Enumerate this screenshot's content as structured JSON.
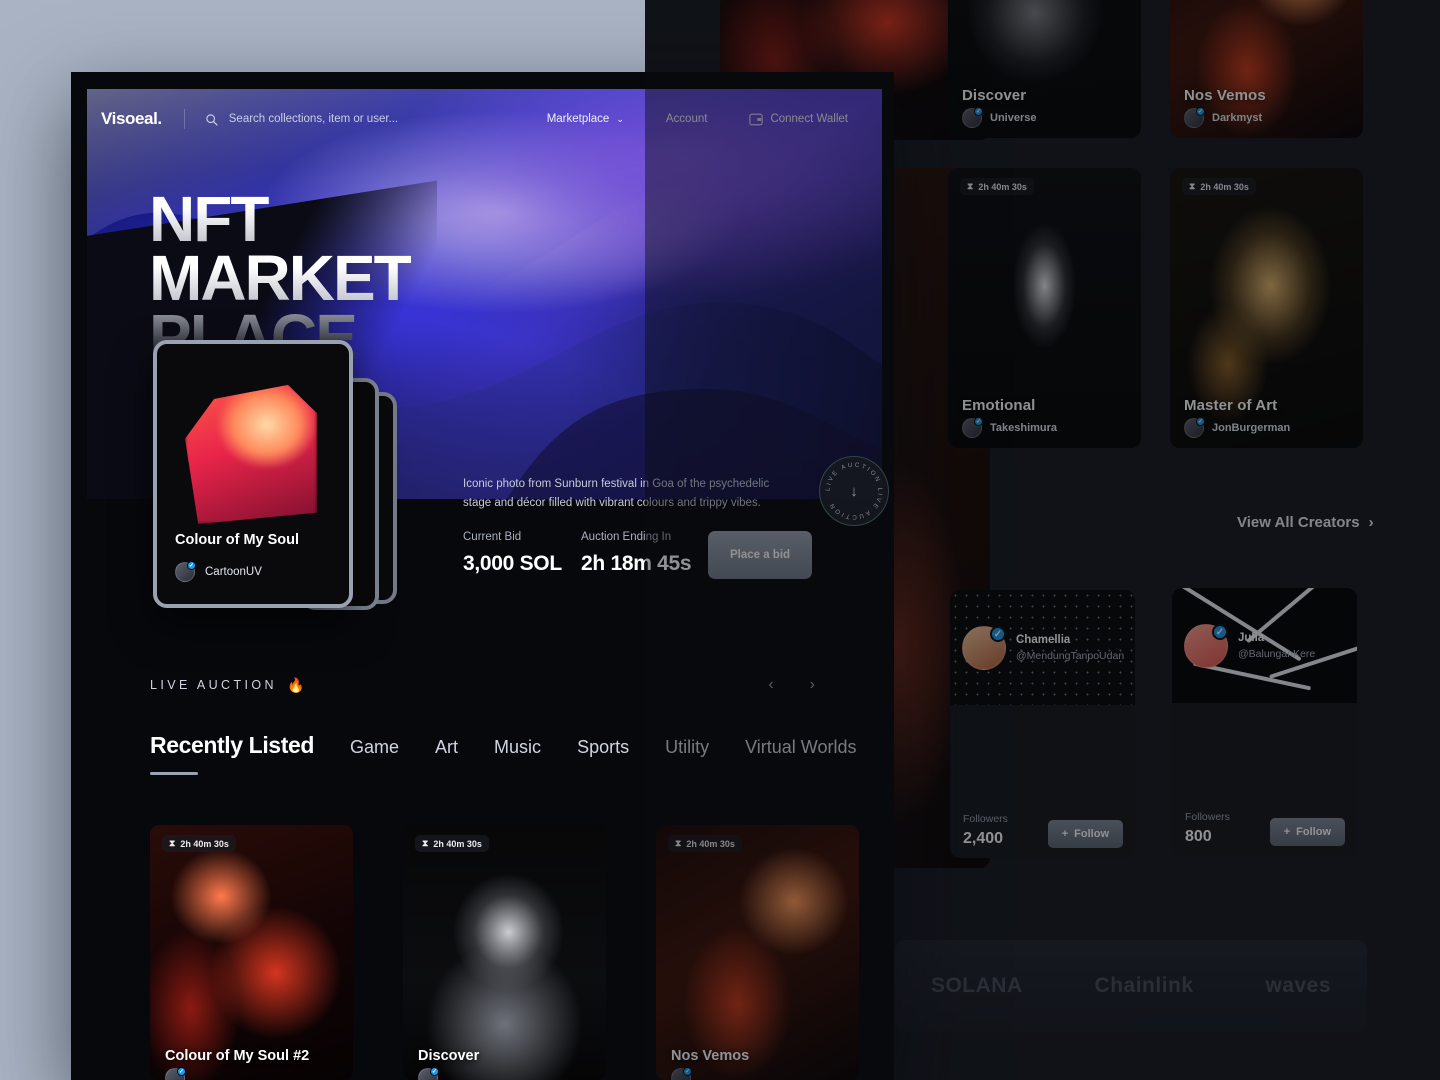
{
  "brand": {
    "logo": "Visoeal."
  },
  "search": {
    "placeholder": "Search collections, item or user..."
  },
  "nav": {
    "marketplace": "Marketplace",
    "account": "Account",
    "connect_wallet": "Connect Wallet"
  },
  "hero": {
    "line1": "NFT",
    "line2": "MARKET",
    "line3": "PLACE",
    "badge_text": "LIVE AUCTION LIVE AUCTION ",
    "description": "Iconic photo from Sunburn festival in Goa of the psychedelic stage and décor filled with vibrant colours and trippy vibes.",
    "current_bid_label": "Current Bid",
    "current_bid_value": "3,000 SOL",
    "ending_label": "Auction Ending In",
    "ending_value": "2h 18m 45s",
    "bid_button": "Place a bid",
    "card": {
      "title": "Colour of My Soul",
      "author": "CartoonUV"
    }
  },
  "live_auction": {
    "label": "LIVE AUCTION",
    "fire": "🔥"
  },
  "tabs": [
    {
      "label": "Recently Listed",
      "active": true
    },
    {
      "label": "Game",
      "active": false
    },
    {
      "label": "Art",
      "active": false
    },
    {
      "label": "Music",
      "active": false
    },
    {
      "label": "Sports",
      "active": false
    },
    {
      "label": "Utility",
      "active": false
    },
    {
      "label": "Virtual Worlds",
      "active": false
    }
  ],
  "listed_cards": [
    {
      "title": "Colour of My Soul #2",
      "timer": "2h 40m 30s"
    },
    {
      "title": "Discover",
      "timer": "2h 40m 30s"
    },
    {
      "title": "Nos Vemos",
      "timer": "2h 40m 30s"
    }
  ],
  "background_page": {
    "top_cards": [
      {
        "title": "Discover",
        "author": "Universe"
      },
      {
        "title": "Nos Vemos",
        "author": "Darkmyst"
      }
    ],
    "mid_cards": [
      {
        "title": "Emotional",
        "author": "Takeshimura",
        "timer": "2h 40m 30s"
      },
      {
        "title": "Master of Art",
        "author": "JonBurgerman",
        "timer": "2h 40m 30s"
      }
    ],
    "view_all": "View All Creators",
    "creators": [
      {
        "name": "Chamellia",
        "handle": "@MendungTanpoUdan",
        "followers_label": "Followers",
        "followers": "2,400",
        "follow": "Follow"
      },
      {
        "name": "Julia",
        "handle": "@BalunganKere",
        "followers_label": "Followers",
        "followers": "800",
        "follow": "Follow"
      }
    ],
    "partners": [
      "SOLANA",
      "Chainlink",
      "waves"
    ]
  },
  "colors": {
    "page_bg": "#a9b3c3",
    "panel_bg": "#07080c",
    "accent_blue": "#3a36e0",
    "verified": "#1d9bf0"
  }
}
